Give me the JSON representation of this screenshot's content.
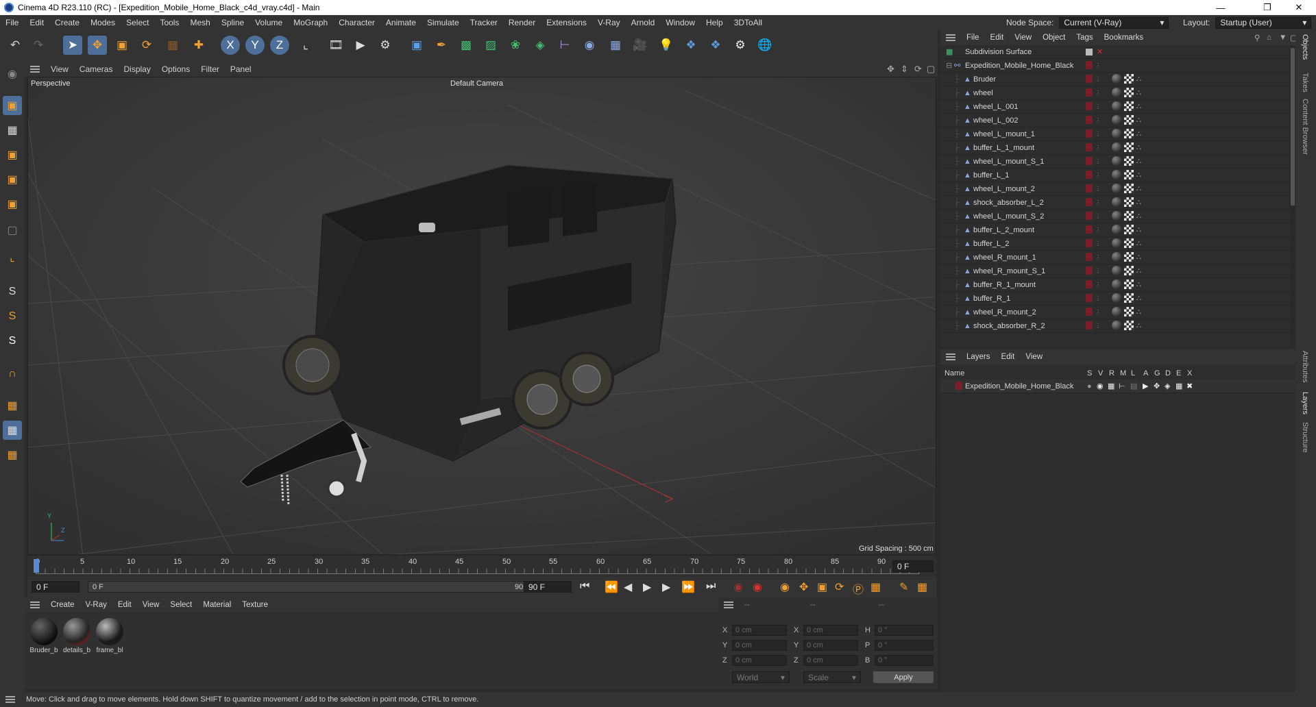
{
  "window": {
    "title": "Cinema 4D R23.110 (RC) - [Expedition_Mobile_Home_Black_c4d_vray.c4d] - Main"
  },
  "menubar": {
    "items": [
      "File",
      "Edit",
      "Create",
      "Modes",
      "Select",
      "Tools",
      "Mesh",
      "Spline",
      "Volume",
      "MoGraph",
      "Character",
      "Animate",
      "Simulate",
      "Tracker",
      "Render",
      "Extensions",
      "V-Ray",
      "Arnold",
      "Window",
      "Help",
      "3DToAll"
    ],
    "node_space_label": "Node Space:",
    "node_space_value": "Current (V-Ray)",
    "layout_label": "Layout:",
    "layout_value": "Startup (User)"
  },
  "viewport_menu": {
    "items": [
      "View",
      "Cameras",
      "Display",
      "Options",
      "Filter",
      "Panel"
    ]
  },
  "viewport": {
    "projection": "Perspective",
    "camera": "Default Camera",
    "grid_spacing": "Grid Spacing : 500 cm",
    "axis_x": "Z",
    "axis_y": "Y"
  },
  "timeline": {
    "ticks": [
      "0",
      "5",
      "10",
      "15",
      "20",
      "25",
      "30",
      "35",
      "40",
      "45",
      "50",
      "55",
      "60",
      "65",
      "70",
      "75",
      "80",
      "85",
      "90"
    ],
    "current_frame": "0 F"
  },
  "transport": {
    "start_field": "0 F",
    "range_start": "0 F",
    "range_end": "90 F",
    "end_field": "90 F"
  },
  "material_panel": {
    "menu": [
      "Create",
      "V-Ray",
      "Edit",
      "View",
      "Select",
      "Material",
      "Texture"
    ],
    "materials": [
      {
        "label": "Bruder_b"
      },
      {
        "label": "details_b"
      },
      {
        "label": "frame_bl"
      }
    ]
  },
  "coord_panel": {
    "headers": [
      "--",
      "--",
      "--"
    ],
    "rows": [
      {
        "a_label": "X",
        "a_value": "0 cm",
        "b_label": "X",
        "b_value": "0 cm",
        "c_label": "H",
        "c_value": "0 °"
      },
      {
        "a_label": "Y",
        "a_value": "0 cm",
        "b_label": "Y",
        "b_value": "0 cm",
        "c_label": "P",
        "c_value": "0 °"
      },
      {
        "a_label": "Z",
        "a_value": "0 cm",
        "b_label": "Z",
        "b_value": "0 cm",
        "c_label": "B",
        "c_value": "0 °"
      }
    ],
    "world_select": "World",
    "scale_select": "Scale",
    "apply_label": "Apply"
  },
  "status": {
    "text": "Move: Click and drag to move elements. Hold down SHIFT to quantize movement / add to the selection in point mode, CTRL to remove."
  },
  "object_panel": {
    "menu": [
      "File",
      "Edit",
      "View",
      "Object",
      "Tags",
      "Bookmarks"
    ],
    "root": "Subdivision Surface",
    "group": "Expedition_Mobile_Home_Black",
    "children": [
      "Bruder",
      "wheel",
      "wheel_L_001",
      "wheel_L_002",
      "wheel_L_mount_1",
      "buffer_L_1_mount",
      "wheel_L_mount_S_1",
      "buffer_L_1",
      "wheel_L_mount_2",
      "shock_absorber_L_2",
      "wheel_L_mount_S_2",
      "buffer_L_2_mount",
      "buffer_L_2",
      "wheel_R_mount_1",
      "wheel_R_mount_S_1",
      "buffer_R_1_mount",
      "buffer_R_1",
      "wheel_R_mount_2",
      "shock_absorber_R_2"
    ]
  },
  "layer_panel": {
    "menu": [
      "Layers",
      "Edit",
      "View"
    ],
    "col_name": "Name",
    "col_flags": [
      "S",
      "V",
      "R",
      "M",
      "L",
      "A",
      "G",
      "D",
      "E",
      "X"
    ],
    "layers": [
      {
        "name": "Expedition_Mobile_Home_Black"
      }
    ]
  },
  "right_tabs": [
    "Objects",
    "Takes",
    "Content Browser",
    "Attributes",
    "Layers",
    "Structure"
  ],
  "colors": {
    "accent_orange": "#f0a030",
    "tag_red": "#7a1f2a",
    "active_blue": "#4d86c8"
  }
}
